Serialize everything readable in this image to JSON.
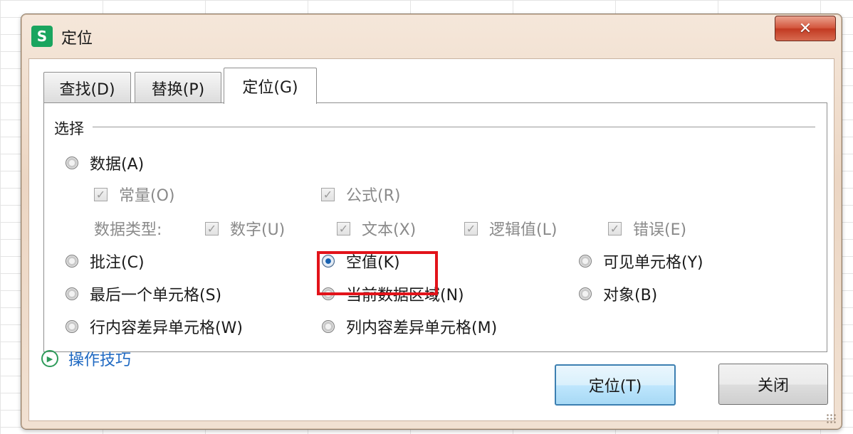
{
  "window": {
    "title": "定位",
    "app_icon_letter": "S",
    "close_symbol": "✕",
    "accent_color": "#1aa55f"
  },
  "tabs": [
    {
      "label": "查找(D)",
      "active": false
    },
    {
      "label": "替换(P)",
      "active": false
    },
    {
      "label": "定位(G)",
      "active": true
    }
  ],
  "select_group": {
    "label": "选择",
    "options": {
      "data": "数据(A)",
      "constant": "常量(O)",
      "formula": "公式(R)",
      "data_type_label": "数据类型:",
      "number": "数字(U)",
      "text": "文本(X)",
      "logical": "逻辑值(L)",
      "error": "错误(E)",
      "comment": "批注(C)",
      "blank": "空值(K)",
      "visible_cells": "可见单元格(Y)",
      "last_cell": "最后一个单元格(S)",
      "current_region": "当前数据区域(N)",
      "objects": "对象(B)",
      "row_diff": "行内容差异单元格(W)",
      "col_diff": "列内容差异单元格(M)"
    },
    "selected": "blank"
  },
  "footer": {
    "tips_link": "操作技巧",
    "locate_button": "定位(T)",
    "close_button": "关闭"
  },
  "highlight_color": "#e2131a"
}
